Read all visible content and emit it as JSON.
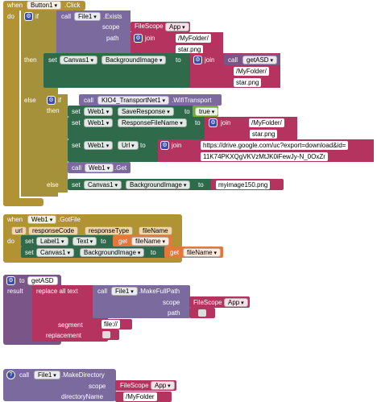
{
  "blocks": {
    "click_event": {
      "when": "when",
      "component": "Button1",
      "event": ".Click",
      "do": "do",
      "if1": "if",
      "call": "call",
      "file_comp": "File1",
      "exists": ".Exists",
      "scope": "scope",
      "filescope": "FileScope",
      "app": "App",
      "path": "path",
      "join": "join",
      "myfolder_slash": "/MyFolder/",
      "star_png": "star.png",
      "then": "then",
      "set": "set",
      "canvas": "Canvas1",
      "bg_image": "BackgroundImage",
      "to": "to",
      "get_asd": "getASD",
      "myfolder_slash2": "/MyFolder/",
      "star_png2": "star.png",
      "else": "else",
      "if2": "if",
      "transport_comp": "KIO4_TransportNet1",
      "wifi": ".WifiTransport",
      "then2": "then",
      "web": "Web1",
      "save_response": "SaveResponse",
      "true_val": "true",
      "response_filename": "ResponseFileName",
      "myfolder_slash3": "/MyFolder/",
      "star_png3": "star.png",
      "url": "Url",
      "url_part1": "https://drive.google.com/uc?export=download&id=",
      "url_part2": "11K74PKXQgVKVzMtJK0iFewJy-N_0OxZr",
      "call_get": "call",
      "web_get": "Web1",
      "get_method": ".Get",
      "else2": "else",
      "myimage": "myimage150.png"
    },
    "gotfile_event": {
      "when": "when",
      "component": "Web1",
      "event": ".GotFile",
      "params": [
        "url",
        "responseCode",
        "responseType",
        "fileName"
      ],
      "do": "do",
      "set": "set",
      "label": "Label1",
      "text_prop": "Text",
      "to": "to",
      "get": "get",
      "filename": "fileName",
      "canvas": "Canvas1",
      "bg_image": "BackgroundImage"
    },
    "getasd_proc": {
      "to": "to",
      "name": "getASD",
      "result": "result",
      "replace_all": "replace all text",
      "call": "call",
      "file_comp": "File1",
      "make_full_path": ".MakeFullPath",
      "scope": "scope",
      "filescope": "FileScope",
      "app": "App",
      "path": "path",
      "segment": "segment",
      "file_str": "file://",
      "replacement": "replacement"
    },
    "make_directory": {
      "call": "call",
      "file_comp": "File1",
      "method": ".MakeDirectory",
      "scope": "scope",
      "filescope": "FileScope",
      "app": "App",
      "dir_name": "directoryName",
      "dir_value": "/MyFolder"
    }
  }
}
